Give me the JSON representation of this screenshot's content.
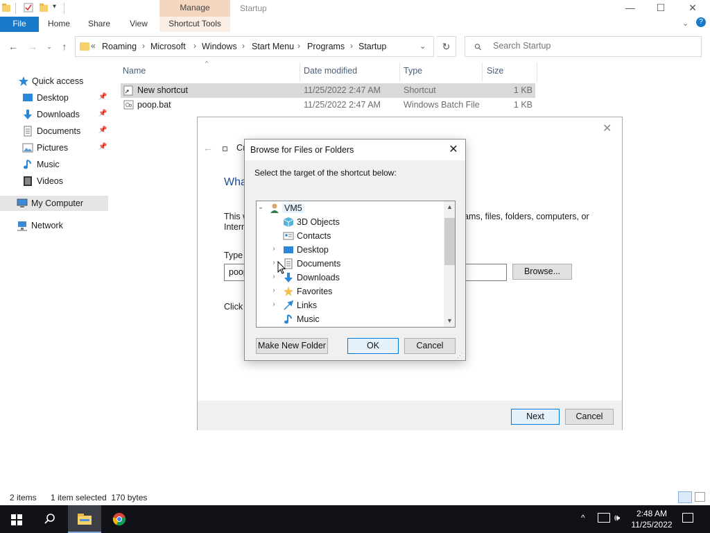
{
  "window": {
    "title": "Startup",
    "manage_tab": "Manage",
    "controls": {
      "minimize": "—",
      "maximize": "☐",
      "close": "✕"
    }
  },
  "ribbon": {
    "tabs": [
      "File",
      "Home",
      "Share",
      "View",
      "Shortcut Tools"
    ]
  },
  "address": {
    "overflow": "«",
    "crumbs": [
      "Roaming",
      "Microsoft",
      "Windows",
      "Start Menu",
      "Programs",
      "Startup"
    ],
    "separator": "›",
    "search_placeholder": "Search Startup"
  },
  "nav": {
    "items": [
      {
        "label": "Quick access",
        "icon": "star-icon",
        "pinned": false
      },
      {
        "label": "Desktop",
        "icon": "desktop-icon",
        "pinned": true
      },
      {
        "label": "Downloads",
        "icon": "download-icon",
        "pinned": true
      },
      {
        "label": "Documents",
        "icon": "document-icon",
        "pinned": true
      },
      {
        "label": "Pictures",
        "icon": "pictures-icon",
        "pinned": true
      },
      {
        "label": "Music",
        "icon": "music-icon",
        "pinned": false
      },
      {
        "label": "Videos",
        "icon": "video-icon",
        "pinned": false
      },
      {
        "label": "My Computer",
        "icon": "computer-icon",
        "pinned": false
      },
      {
        "label": "Network",
        "icon": "network-icon",
        "pinned": false
      }
    ]
  },
  "filelist": {
    "columns": [
      "Name",
      "Date modified",
      "Type",
      "Size"
    ],
    "rows": [
      {
        "name": "New shortcut",
        "date": "11/25/2022 2:47 AM",
        "type": "Shortcut",
        "size": "1 KB"
      },
      {
        "name": "poop.bat",
        "date": "11/25/2022 2:47 AM",
        "type": "Windows Batch File",
        "size": "1 KB"
      }
    ]
  },
  "status": {
    "items": "2 items",
    "selected": "1 item selected  170 bytes"
  },
  "wizard": {
    "title_partial": "Cı",
    "heading_partial": "Wha",
    "desc_left": "This w",
    "desc_left2": "Intern",
    "desc_right": "ams, files, folders, computers, or",
    "type_label_partial": "Type t",
    "path_value": "poop",
    "click_partial": "Click",
    "browse_label": "Browse...",
    "next_label": "Next",
    "cancel_label": "Cancel"
  },
  "browse": {
    "title": "Browse for Files or Folders",
    "instruction": "Select the target of the shortcut below:",
    "tree": [
      {
        "label": "VM5",
        "icon": "user-icon",
        "expander": "expanded"
      },
      {
        "label": "3D Objects",
        "icon": "3d-objects-icon",
        "expander": "none"
      },
      {
        "label": "Contacts",
        "icon": "contacts-icon",
        "expander": "none"
      },
      {
        "label": "Desktop",
        "icon": "desktop-icon",
        "expander": "collapsed"
      },
      {
        "label": "Documents",
        "icon": "document-icon",
        "expander": "collapsed"
      },
      {
        "label": "Downloads",
        "icon": "download-icon",
        "expander": "collapsed"
      },
      {
        "label": "Favorites",
        "icon": "favorites-icon",
        "expander": "collapsed"
      },
      {
        "label": "Links",
        "icon": "links-icon",
        "expander": "collapsed"
      },
      {
        "label": "Music",
        "icon": "music-icon",
        "expander": "none"
      }
    ],
    "new_folder_label": "Make New Folder",
    "ok_label": "OK",
    "cancel_label": "Cancel"
  },
  "taskbar": {
    "time": "2:48 AM",
    "date": "11/25/2022"
  },
  "colors": {
    "accent": "#1979ca",
    "manage_tab": "#f4d6c1",
    "taskbar": "#101217",
    "selection": "#d9d9d9"
  }
}
